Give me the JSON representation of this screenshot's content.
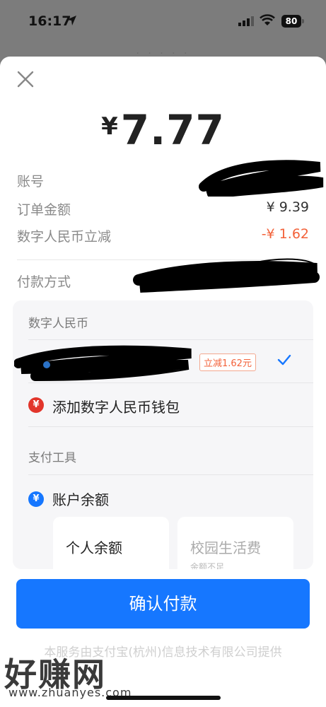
{
  "status_bar": {
    "time": "16:17",
    "battery": "80"
  },
  "peek_title": "· · · · ·",
  "amount": {
    "symbol": "¥",
    "value": "7.77"
  },
  "rows": {
    "account_label": "账号",
    "order_label": "订单金额",
    "order_value": "¥ 9.39",
    "discount_label": "数字人民币立减",
    "discount_value": "-¥ 1.62",
    "method_label": "付款方式"
  },
  "payment": {
    "ecny_title": "数字人民币",
    "discount_badge": "立减1.62元",
    "add_wallet": "添加数字人民币钱包",
    "tools_title": "支付工具",
    "balance_label": "账户余额",
    "tiles": [
      {
        "label": "个人余额",
        "sub": ""
      },
      {
        "label": "校园生活费",
        "sub": "余额不足"
      }
    ]
  },
  "confirm_label": "确认付款",
  "footer_note": "本服务由支付宝(杭州)信息技术有限公司提供",
  "watermark": {
    "text": "好赚网",
    "url": "www.zhuanyes.com"
  },
  "colors": {
    "accent": "#1677ff",
    "discount": "#f3623a",
    "ecny": "#e2352b"
  }
}
